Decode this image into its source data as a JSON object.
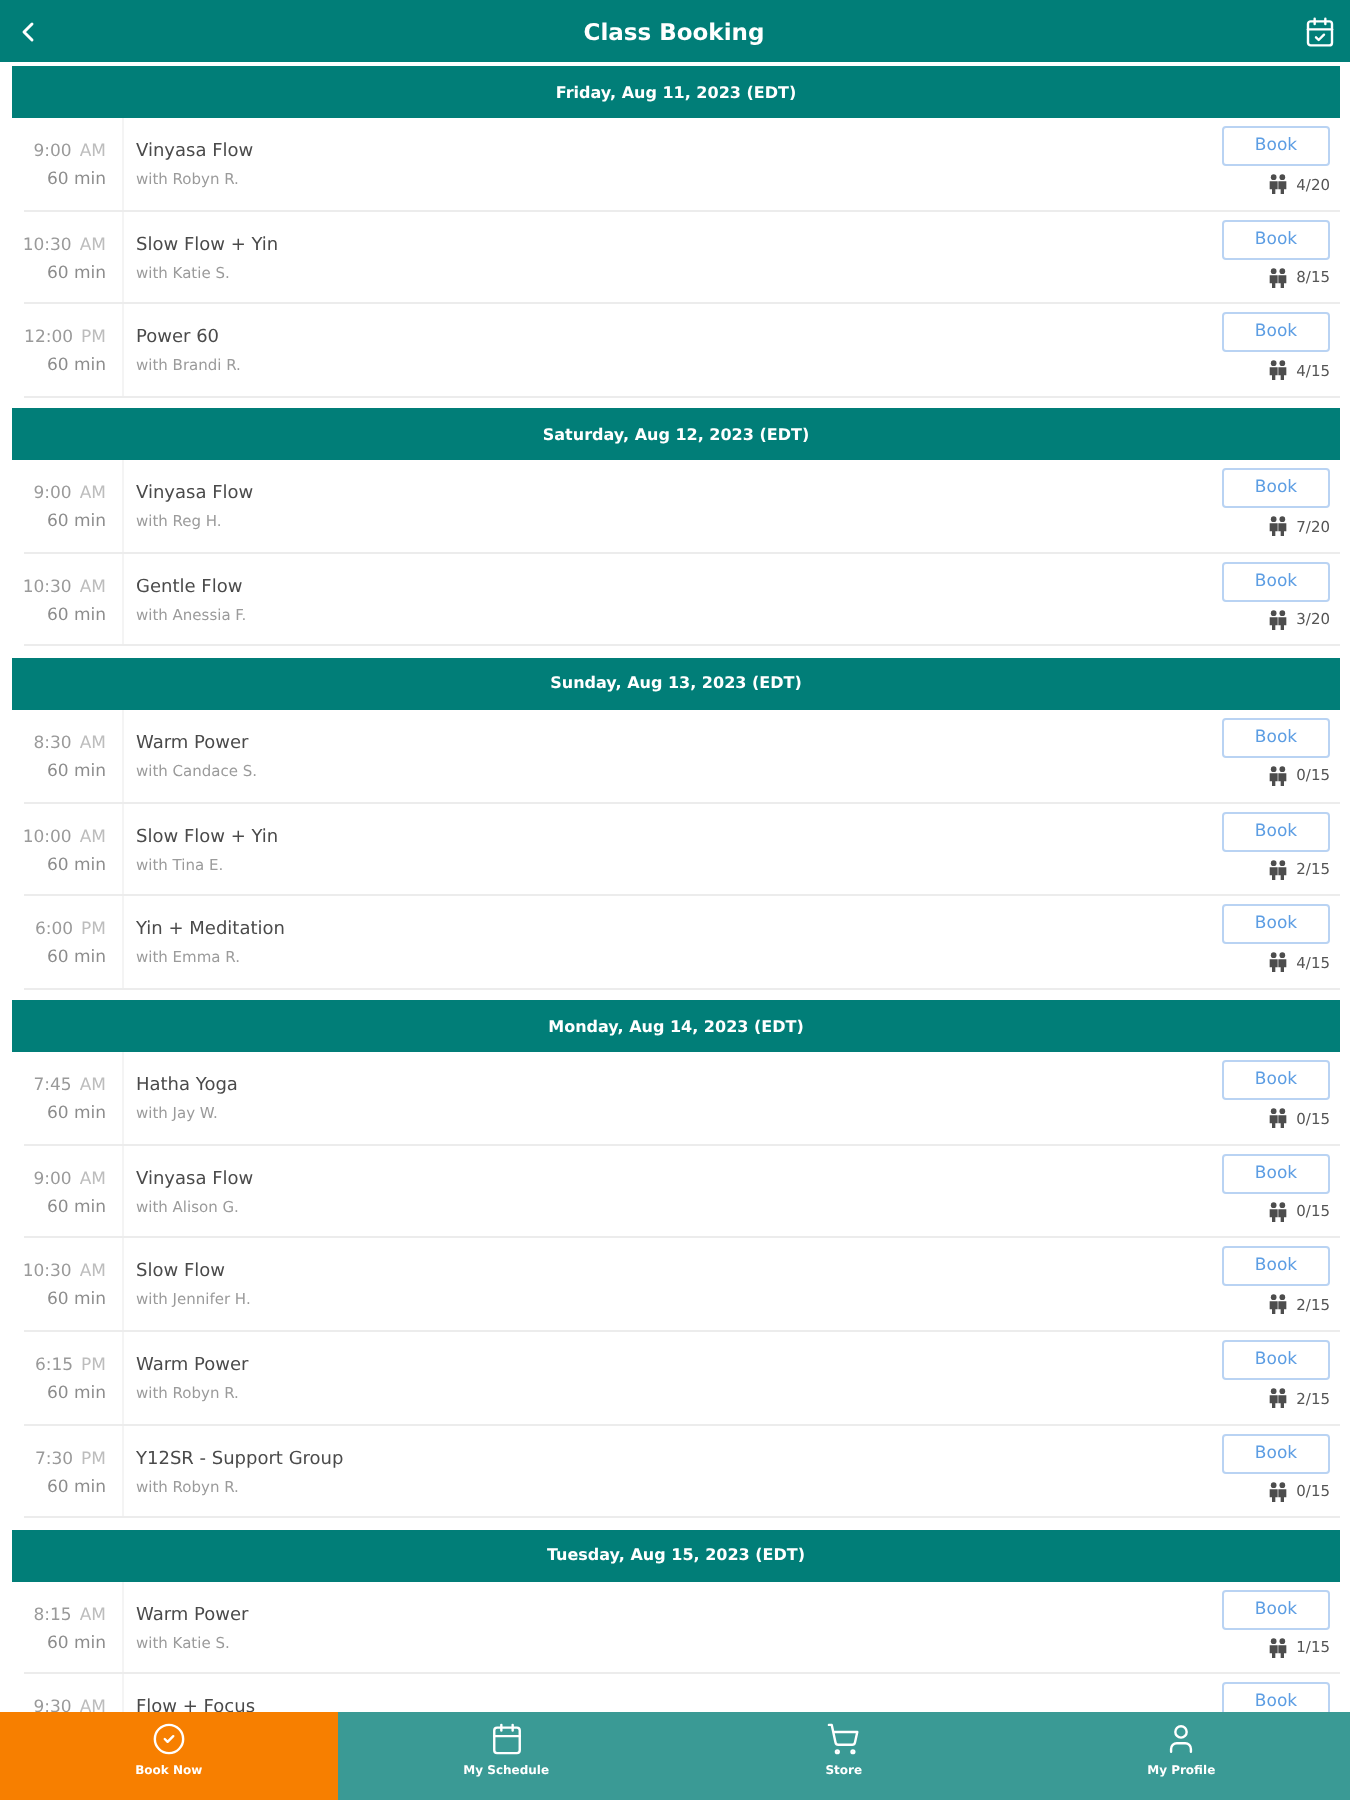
{
  "top_bar": {
    "title": "Class Booking"
  },
  "days": [
    {
      "date": "Friday, Aug 11, 2023 (EDT)",
      "classes": [
        {
          "time": "9:00",
          "period": "AM",
          "duration": "60 min",
          "name": "Vinyasa Flow",
          "instructor": "with Robyn R.",
          "button": "Book",
          "spots": "4/20"
        },
        {
          "time": "10:30",
          "period": "AM",
          "duration": "60 min",
          "name": "Slow Flow + Yin",
          "instructor": "with Katie S.",
          "button": "Book",
          "spots": "8/15"
        },
        {
          "time": "12:00",
          "period": "PM",
          "duration": "60 min",
          "name": "Power 60",
          "instructor": "with Brandi R.",
          "button": "Book",
          "spots": "4/15"
        }
      ]
    },
    {
      "date": "Saturday, Aug 12, 2023 (EDT)",
      "classes": [
        {
          "time": "9:00",
          "period": "AM",
          "duration": "60 min",
          "name": "Vinyasa Flow",
          "instructor": "with Reg H.",
          "button": "Book",
          "spots": "7/20"
        },
        {
          "time": "10:30",
          "period": "AM",
          "duration": "60 min",
          "name": "Gentle Flow",
          "instructor": "with Anessia F.",
          "button": "Book",
          "spots": "3/20"
        }
      ]
    },
    {
      "date": "Sunday, Aug 13, 2023 (EDT)",
      "classes": [
        {
          "time": "8:30",
          "period": "AM",
          "duration": "60 min",
          "name": "Warm Power",
          "instructor": "with Candace S.",
          "button": "Book",
          "spots": "0/15"
        },
        {
          "time": "10:00",
          "period": "AM",
          "duration": "60 min",
          "name": "Slow Flow + Yin",
          "instructor": "with Tina E.",
          "button": "Book",
          "spots": "2/15"
        },
        {
          "time": "6:00",
          "period": "PM",
          "duration": "60 min",
          "name": "Yin + Meditation",
          "instructor": "with Emma R.",
          "button": "Book",
          "spots": "4/15"
        }
      ]
    },
    {
      "date": "Monday, Aug 14, 2023 (EDT)",
      "classes": [
        {
          "time": "7:45",
          "period": "AM",
          "duration": "60 min",
          "name": "Hatha Yoga",
          "instructor": "with Jay W.",
          "button": "Book",
          "spots": "0/15"
        },
        {
          "time": "9:00",
          "period": "AM",
          "duration": "60 min",
          "name": "Vinyasa Flow",
          "instructor": "with Alison G.",
          "button": "Book",
          "spots": "0/15"
        },
        {
          "time": "10:30",
          "period": "AM",
          "duration": "60 min",
          "name": "Slow Flow",
          "instructor": "with Jennifer H.",
          "button": "Book",
          "spots": "2/15"
        },
        {
          "time": "6:15",
          "period": "PM",
          "duration": "60 min",
          "name": "Warm Power",
          "instructor": "with Robyn R.",
          "button": "Book",
          "spots": "2/15"
        },
        {
          "time": "7:30",
          "period": "PM",
          "duration": "60 min",
          "name": "Y12SR - Support Group",
          "instructor": "with Robyn R.",
          "button": "Book",
          "spots": "0/15"
        }
      ]
    },
    {
      "date": "Tuesday, Aug 15, 2023 (EDT)",
      "classes": [
        {
          "time": "8:15",
          "period": "AM",
          "duration": "60 min",
          "name": "Warm Power",
          "instructor": "with Katie S.",
          "button": "Book",
          "spots": "1/15"
        },
        {
          "time": "9:30",
          "period": "AM",
          "name": "Flow + Focus",
          "button": "Book"
        }
      ]
    }
  ],
  "nav": [
    {
      "label": "Book Now",
      "selected": true
    },
    {
      "label": "My Schedule",
      "selected": false
    },
    {
      "label": "Store",
      "selected": false
    },
    {
      "label": "My Profile",
      "selected": false
    }
  ]
}
